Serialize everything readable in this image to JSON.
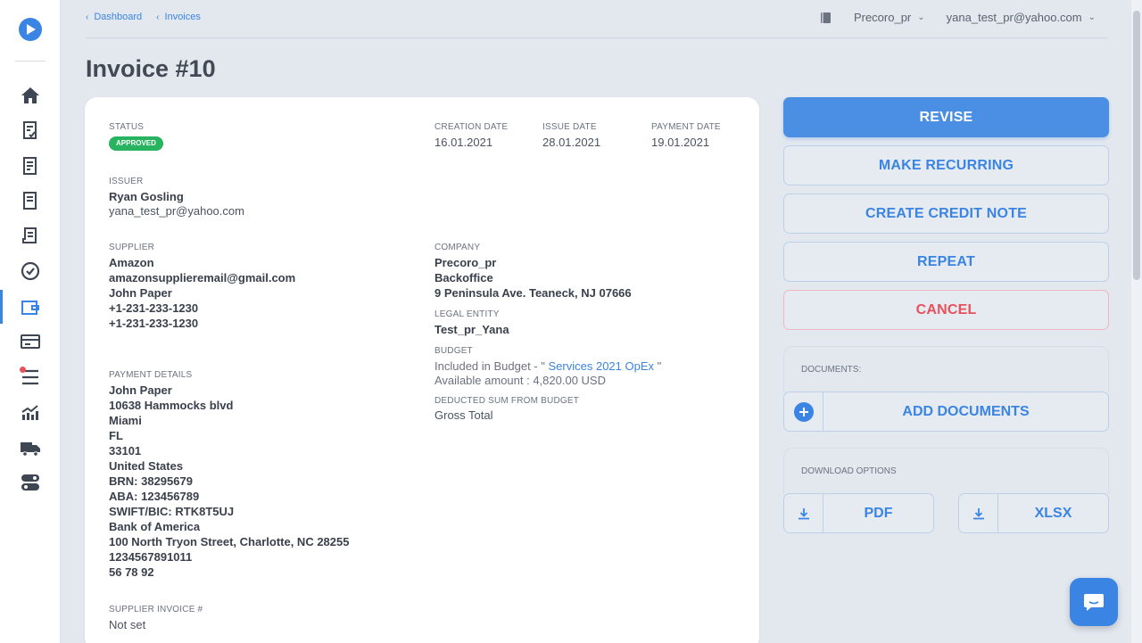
{
  "breadcrumb": [
    {
      "label": "Dashboard"
    },
    {
      "label": "Invoices"
    }
  ],
  "header": {
    "company": "Precoro_pr",
    "user": "yana_test_pr@yahoo.com"
  },
  "page": {
    "title": "Invoice #10"
  },
  "invoice": {
    "status_label": "STATUS",
    "status": "APPROVED",
    "creation_date_label": "CREATION DATE",
    "creation_date": "16.01.2021",
    "issue_date_label": "ISSUE DATE",
    "issue_date": "28.01.2021",
    "payment_date_label": "PAYMENT DATE",
    "payment_date": "19.01.2021",
    "issuer_label": "ISSUER",
    "issuer_name": "Ryan Gosling",
    "issuer_email": "yana_test_pr@yahoo.com",
    "supplier_label": "SUPPLIER",
    "supplier_lines": [
      "Amazon",
      "amazonsupplieremail@gmail.com",
      "John Paper",
      "+1-231-233-1230",
      "+1-231-233-1230"
    ],
    "company_label": "COMPANY",
    "company_lines": [
      "Precoro_pr",
      "Backoffice",
      "9 Peninsula Ave. Teaneck, NJ 07666"
    ],
    "legal_entity_label": "LEGAL ENTITY",
    "legal_entity": "Test_pr_Yana",
    "budget_label": "BUDGET",
    "budget_prefix": "Included in Budget - \"",
    "budget_name": "Services 2021 OpEx",
    "budget_suffix": "\"",
    "budget_available": "Available amount : 4,820.00 USD",
    "deducted_label": "DEDUCTED SUM FROM BUDGET",
    "deducted_value": "Gross Total",
    "payment_details_label": "PAYMENT DETAILS",
    "payment_lines": [
      "John Paper",
      "10638 Hammocks blvd",
      "Miami",
      "FL",
      "33101",
      "United States",
      "BRN: 38295679",
      "ABA: 123456789",
      "SWIFT/BIC: RTK8T5UJ",
      "Bank of America",
      "100 North Tryon Street, Charlotte, NC 28255",
      "1234567891011",
      "56 78 92"
    ],
    "supplier_invoice_label": "SUPPLIER INVOICE #",
    "supplier_invoice": "Not set"
  },
  "actions": {
    "revise": "REVISE",
    "make_recurring": "MAKE RECURRING",
    "create_credit_note": "CREATE CREDIT NOTE",
    "repeat": "REPEAT",
    "cancel": "CANCEL"
  },
  "documents": {
    "label": "DOCUMENTS:",
    "add": "ADD DOCUMENTS"
  },
  "download": {
    "label": "DOWNLOAD OPTIONS",
    "pdf": "PDF",
    "xlsx": "XLSX"
  },
  "colors": {
    "accent": "#3a84e3",
    "approved": "#27b35f",
    "danger": "#e8505b"
  }
}
